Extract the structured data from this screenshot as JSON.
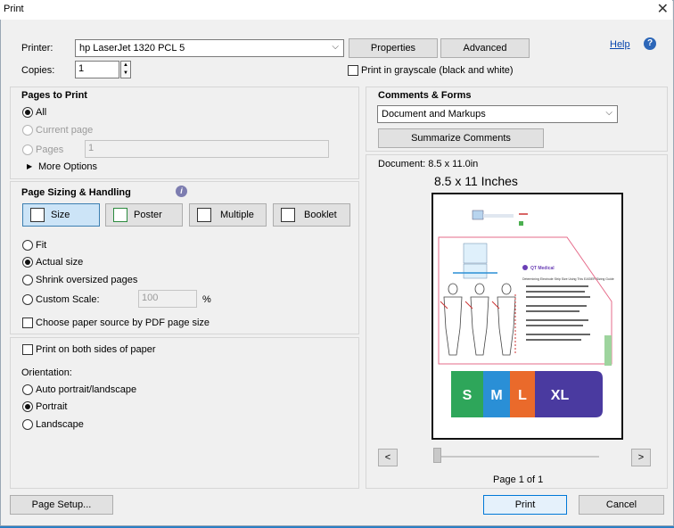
{
  "window": {
    "title": "Print",
    "close": "✕"
  },
  "printer": {
    "label": "Printer:",
    "value": "hp LaserJet 1320 PCL 5",
    "properties": "Properties",
    "advanced": "Advanced"
  },
  "help": {
    "label": "Help",
    "icon": "?"
  },
  "copies": {
    "label": "Copies:",
    "value": "1"
  },
  "grayscale": {
    "label": "Print in grayscale (black and white)"
  },
  "pages_to_print": {
    "title": "Pages to Print",
    "all": "All",
    "current": "Current page",
    "pages": "Pages",
    "pages_value": "1",
    "more": "More Options"
  },
  "sizing": {
    "title": "Page Sizing & Handling",
    "info_icon": "i",
    "buttons": [
      "Size",
      "Poster",
      "Multiple",
      "Booklet"
    ],
    "fit": "Fit",
    "actual": "Actual size",
    "shrink": "Shrink oversized pages",
    "custom": "Custom Scale:",
    "custom_value": "100",
    "percent": "%",
    "paper_source": "Choose paper source by PDF page size"
  },
  "duplex": {
    "label": "Print on both sides of paper"
  },
  "orientation": {
    "title": "Orientation:",
    "auto": "Auto portrait/landscape",
    "portrait": "Portrait",
    "landscape": "Landscape"
  },
  "comments": {
    "title": "Comments & Forms",
    "value": "Document and Markups",
    "summarize": "Summarize Comments"
  },
  "preview": {
    "doc": "Document: 8.5 x 11.0in",
    "size": "8.5 x 11 Inches",
    "page": "Page 1 of 1",
    "prev": "<",
    "next": ">"
  },
  "thumb": {
    "brand": "QT Medical",
    "heading": "Determining Electrode Strip Size Using This EASIER Sizing Guide",
    "sizes": [
      "S",
      "M",
      "L",
      "XL"
    ]
  },
  "footer": {
    "setup": "Page Setup...",
    "print": "Print",
    "cancel": "Cancel"
  },
  "colors": {
    "accent": "#0078d7",
    "size_s": "#2ea65a",
    "size_m": "#2a8fd6",
    "size_l": "#ea6a2b",
    "size_xl": "#4a3aa0"
  }
}
